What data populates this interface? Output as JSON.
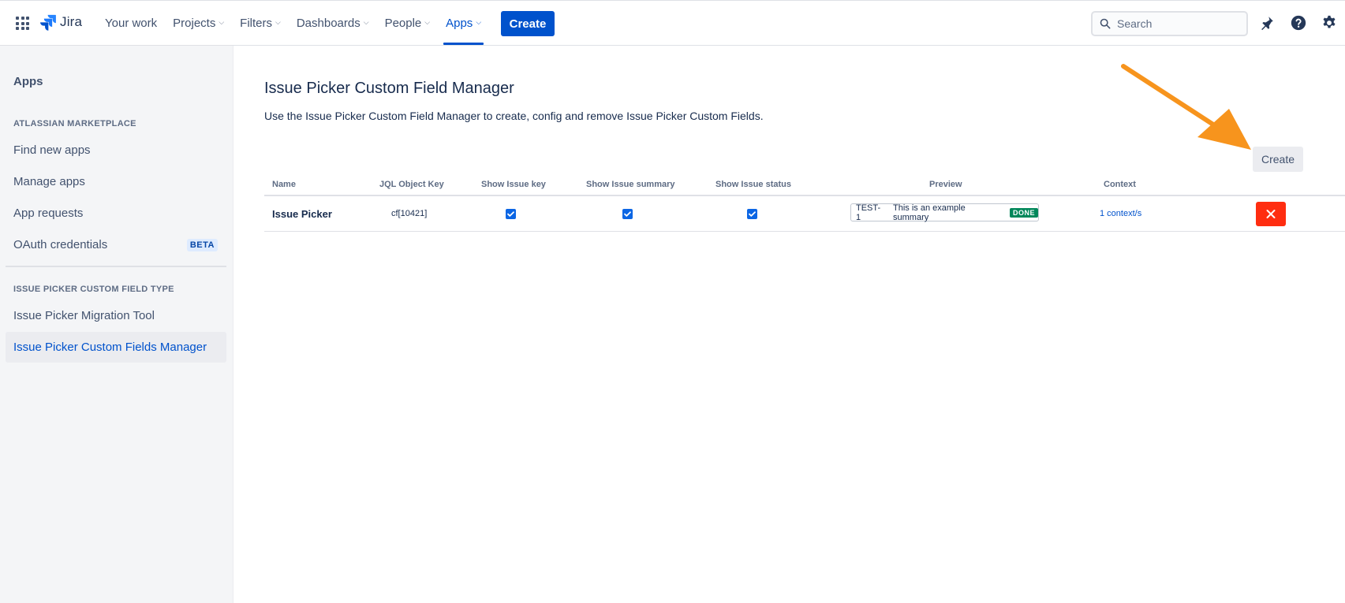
{
  "topbar": {
    "logo_text": "Jira",
    "nav": [
      {
        "label": "Your work",
        "dropdown": false,
        "active": false
      },
      {
        "label": "Projects",
        "dropdown": true,
        "active": false
      },
      {
        "label": "Filters",
        "dropdown": true,
        "active": false
      },
      {
        "label": "Dashboards",
        "dropdown": true,
        "active": false
      },
      {
        "label": "People",
        "dropdown": true,
        "active": false
      },
      {
        "label": "Apps",
        "dropdown": true,
        "active": true
      }
    ],
    "create_label": "Create",
    "search_placeholder": "Search",
    "icons": [
      "notifications-icon",
      "help-icon",
      "settings-icon"
    ]
  },
  "sidebar": {
    "title": "Apps",
    "section1_heading": "ATLASSIAN MARKETPLACE",
    "section1_items": [
      {
        "label": "Find new apps"
      },
      {
        "label": "Manage apps"
      },
      {
        "label": "App requests"
      },
      {
        "label": "OAuth credentials",
        "badge": "BETA"
      }
    ],
    "section2_heading": "ISSUE PICKER CUSTOM FIELD TYPE",
    "section2_items": [
      {
        "label": "Issue Picker Migration Tool",
        "selected": false
      },
      {
        "label": "Issue Picker Custom Fields Manager",
        "selected": true
      }
    ]
  },
  "main": {
    "title": "Issue Picker Custom Field Manager",
    "description": "Use the Issue Picker Custom Field Manager to create, config and remove Issue Picker Custom Fields.",
    "create_button": "Create",
    "table": {
      "columns": [
        "Name",
        "JQL Object Key",
        "Show Issue key",
        "Show Issue summary",
        "Show Issue status",
        "Preview",
        "Context"
      ],
      "rows": [
        {
          "name": "Issue Picker",
          "jql_key": "cf[10421]",
          "show_key": true,
          "show_summary": true,
          "show_status": true,
          "preview": {
            "key": "TEST-1",
            "summary": "This is an example summary",
            "status": "DONE"
          },
          "context": "1 context/s"
        }
      ]
    }
  },
  "colors": {
    "brand_blue": "#0052cc",
    "delete_red": "#ff2d10",
    "done_green": "#00875a",
    "annotation_arrow": "#f7941d"
  }
}
